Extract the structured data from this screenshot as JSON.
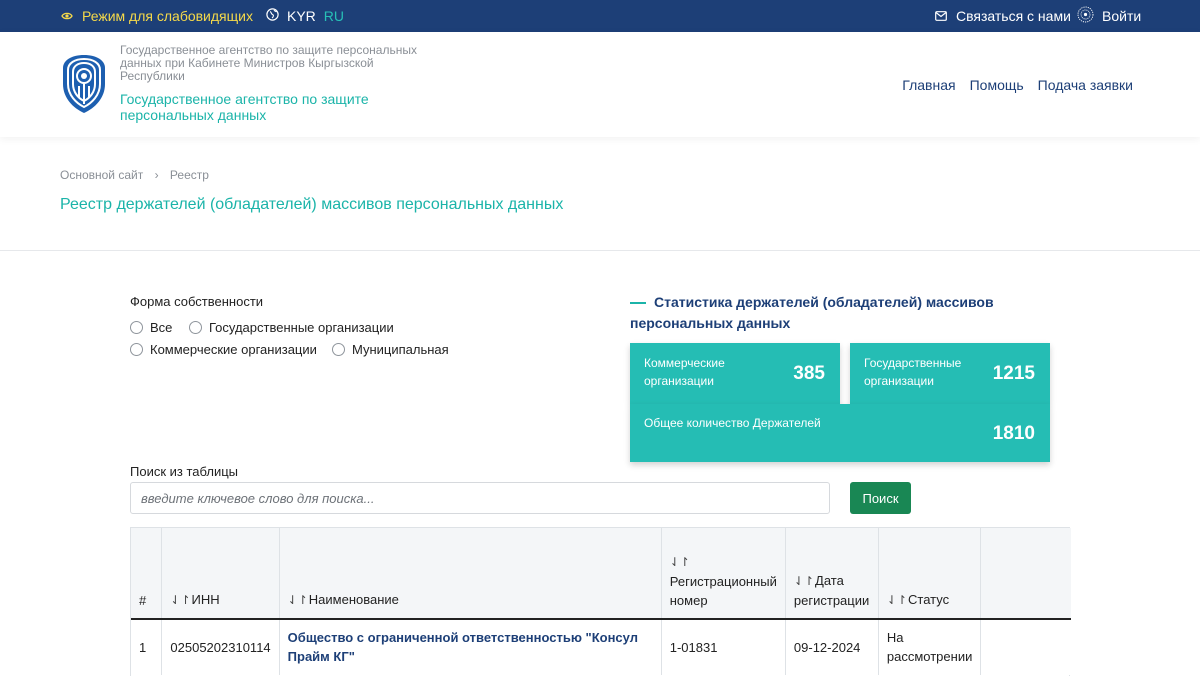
{
  "topbar": {
    "accessibility_label": "Режим для слабовидящих",
    "lang_kyr": "KYR",
    "lang_ru": "RU",
    "contact_label": "Связаться с нами",
    "login_label": "Войти"
  },
  "header": {
    "agency_small": "Государственное агентство по защите персональных данных при Кабинете Министров Кыргызской Республики",
    "agency_main": "Государственное агентство по защите персональных данных",
    "nav": [
      "Главная",
      "Помощь",
      "Подача заявки"
    ]
  },
  "breadcrumb": {
    "items": [
      "Основной сайт",
      "Реестр"
    ],
    "separator": "›"
  },
  "page_title": "Реестр держателей (обладателей) массивов персональных данных",
  "filter": {
    "label": "Форма собственности",
    "options": [
      "Все",
      "Государственные организации",
      "Коммерческие организации",
      "Муниципальная"
    ]
  },
  "stats": {
    "title": "Статистика держателей (обладателей) массивов персональных данных",
    "commercial_label": "Коммерческие организации",
    "commercial_value": "385",
    "state_label": "Государственные организации",
    "state_value": "1215",
    "total_label": "Общее количество Держателей",
    "total_value": "1810"
  },
  "search": {
    "label": "Поиск из таблицы",
    "placeholder": "введите ключевое слово для поиска...",
    "value": "",
    "button_label": "Поиск"
  },
  "table": {
    "sort_icon": "⇃↾",
    "headers": [
      "#",
      "ИНН",
      "Наименование",
      "Регистрационный номер",
      "Дата регистрации",
      "Статус",
      ""
    ],
    "rows": [
      {
        "num": "1",
        "inn": "02505202310114",
        "name": "Общество с ограниченной ответственностью \"Консул Прайм КГ\"",
        "reg_number": "1-01831",
        "reg_date": "09-12-2024",
        "status": "На рассмотрении",
        "extra": ""
      }
    ]
  },
  "colors": {
    "topbar_bg": "#1d3f77",
    "accent_teal": "#1bb4a9",
    "card_teal": "#25bdb4",
    "accessibility_yellow": "#f5d94a",
    "search_button_green": "#198754"
  },
  "icons": {
    "accessibility": "eye-icon",
    "language": "globe-icon",
    "contact": "envelope-icon",
    "login": "globe-login-icon",
    "logo": "agency-shield-logo"
  }
}
